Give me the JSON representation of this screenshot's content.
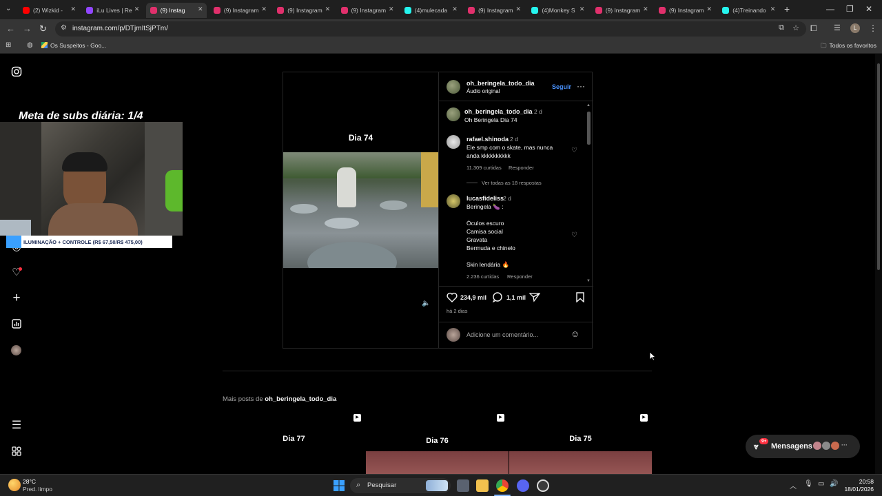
{
  "browser": {
    "tabs": [
      {
        "label": "(2) Wizkid - ",
        "color": "#ff0000"
      },
      {
        "label": "iLu Lives | Re",
        "color": "#9146ff"
      },
      {
        "label": "(9) Instag",
        "color": "#e1306c",
        "active": true
      },
      {
        "label": "(9) Instagram",
        "color": "#e1306c"
      },
      {
        "label": "(9) Instagram",
        "color": "#e1306c"
      },
      {
        "label": "(9) Instagram",
        "color": "#e1306c"
      },
      {
        "label": "(4)mulecada",
        "color": "#25f4ee"
      },
      {
        "label": "(9) Instagram",
        "color": "#e1306c"
      },
      {
        "label": "(4)Monkey S",
        "color": "#25f4ee"
      },
      {
        "label": "(9) Instagram",
        "color": "#e1306c"
      },
      {
        "label": "(9) Instagram",
        "color": "#e1306c"
      },
      {
        "label": "(4)Treinando",
        "color": "#25f4ee"
      }
    ],
    "url": "instagram.com/p/DTjmItSjPTm/",
    "bookmark": "Os Suspeitos - Goo...",
    "all_bookmarks": "Todos os favoritos",
    "profile_initial": "L"
  },
  "overlay": {
    "meta_text": "Meta de subs diária: 1/4",
    "banner_text": "ILUMINAÇÃO + CONTROLE (R$ 67,50/R$ 475,00)"
  },
  "post": {
    "video_title": "Dia 74",
    "author": "oh_beringela_todo_dia",
    "audio": "Áudio original",
    "follow": "Seguir",
    "caption_user": "oh_beringela_todo_dia",
    "caption_time": "2 d",
    "caption_text": "Oh Beringela Dia 74",
    "comments": [
      {
        "user": "rafael.shinoda",
        "time": "2 d",
        "lines": [
          "Ele smp com o skate, mas nunca",
          "anda kkkkkkkkkk"
        ],
        "likes": "11.309 curtidas",
        "reply": "Responder",
        "view_replies": "Ver todas as 18 respostas"
      },
      {
        "user": "lucasfideliss",
        "time": "2 d",
        "lines": [
          "Beringela 🍆 :",
          "",
          "Óculos escuro",
          "Camisa social",
          "Gravata",
          "Bermuda e chinelo",
          "",
          "Skin lendária 🔥"
        ],
        "likes": "2.236 curtidas",
        "reply": "Responder"
      }
    ],
    "like_count": "234,9 mil",
    "comment_count": "1,1 mil",
    "posted": "há 2 dias",
    "add_comment_placeholder": "Adicione um comentário..."
  },
  "more_posts": {
    "label_prefix": "Mais posts de",
    "label_user": "oh_beringela_todo_dia",
    "thumbs": [
      {
        "title": "Dia 77"
      },
      {
        "title": "Dia 76"
      },
      {
        "title": "Dia 75"
      }
    ]
  },
  "messages": {
    "label": "Mensagens",
    "badge": "9+"
  },
  "taskbar": {
    "temp": "28°C",
    "weather": "Pred. limpo",
    "search": "Pesquisar",
    "time": "20:58",
    "date": "18/01/2026"
  }
}
